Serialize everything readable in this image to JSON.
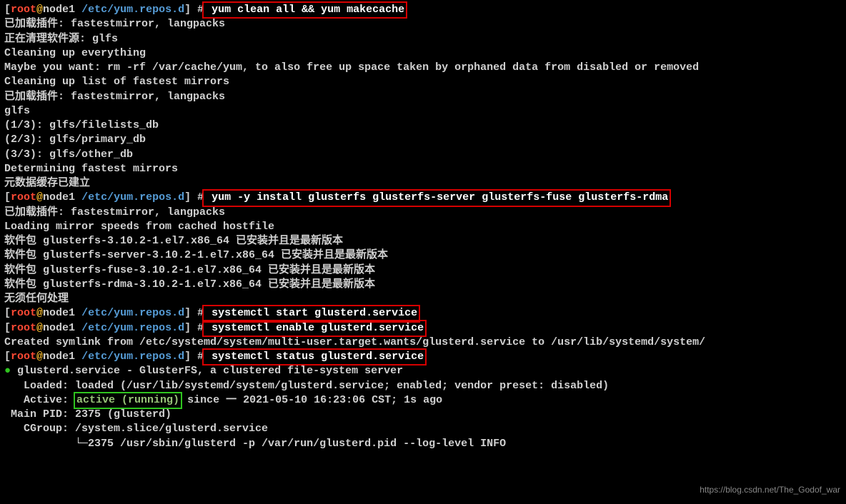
{
  "prompt": {
    "bracket_open": "[",
    "user": "root",
    "at": "@",
    "host": "node1",
    "path": " /etc/yum.repos.d",
    "bracket_close": "]",
    "hash": " #"
  },
  "cmd1": " yum clean all && yum makecache",
  "out1": [
    "已加载插件: fastestmirror, langpacks",
    "正在清理软件源: glfs",
    "Cleaning up everything",
    "Maybe you want: rm -rf /var/cache/yum, to also free up space taken by orphaned data from disabled or removed",
    "Cleaning up list of fastest mirrors",
    "已加载插件: fastestmirror, langpacks",
    "glfs",
    "(1/3): glfs/filelists_db",
    "(2/3): glfs/primary_db",
    "(3/3): glfs/other_db",
    "Determining fastest mirrors",
    "元数据缓存已建立"
  ],
  "cmd2": " yum -y install glusterfs glusterfs-server glusterfs-fuse glusterfs-rdma",
  "out2": [
    "已加载插件: fastestmirror, langpacks",
    "Loading mirror speeds from cached hostfile",
    "软件包 glusterfs-3.10.2-1.el7.x86_64 已安装并且是最新版本",
    "软件包 glusterfs-server-3.10.2-1.el7.x86_64 已安装并且是最新版本",
    "软件包 glusterfs-fuse-3.10.2-1.el7.x86_64 已安装并且是最新版本",
    "软件包 glusterfs-rdma-3.10.2-1.el7.x86_64 已安装并且是最新版本",
    "无须任何处理"
  ],
  "cmd3": " systemctl start glusterd.service",
  "cmd4": " systemctl enable glusterd.service",
  "out4": "Created symlink from /etc/systemd/system/multi-user.target.wants/glusterd.service to /usr/lib/systemd/system/",
  "cmd5": " systemctl status glusterd.service",
  "status": {
    "bullet": "●",
    "title": " glusterd.service - GlusterFS, a clustered file-system server",
    "loaded": "   Loaded: loaded (/usr/lib/systemd/system/glusterd.service; enabled; vendor preset: disabled)",
    "active_label": "   Active: ",
    "active_val": "active (running)",
    "active_rest": " since 一 2021-05-10 16:23:06 CST; 1s ago",
    "mainpid": " Main PID: 2375 (glusterd)",
    "cgroup": "   CGroup: /system.slice/glusterd.service",
    "cgroup_child": "           └─2375 /usr/sbin/glusterd -p /var/run/glusterd.pid --log-level INFO"
  },
  "watermark": "https://blog.csdn.net/The_Godof_war"
}
